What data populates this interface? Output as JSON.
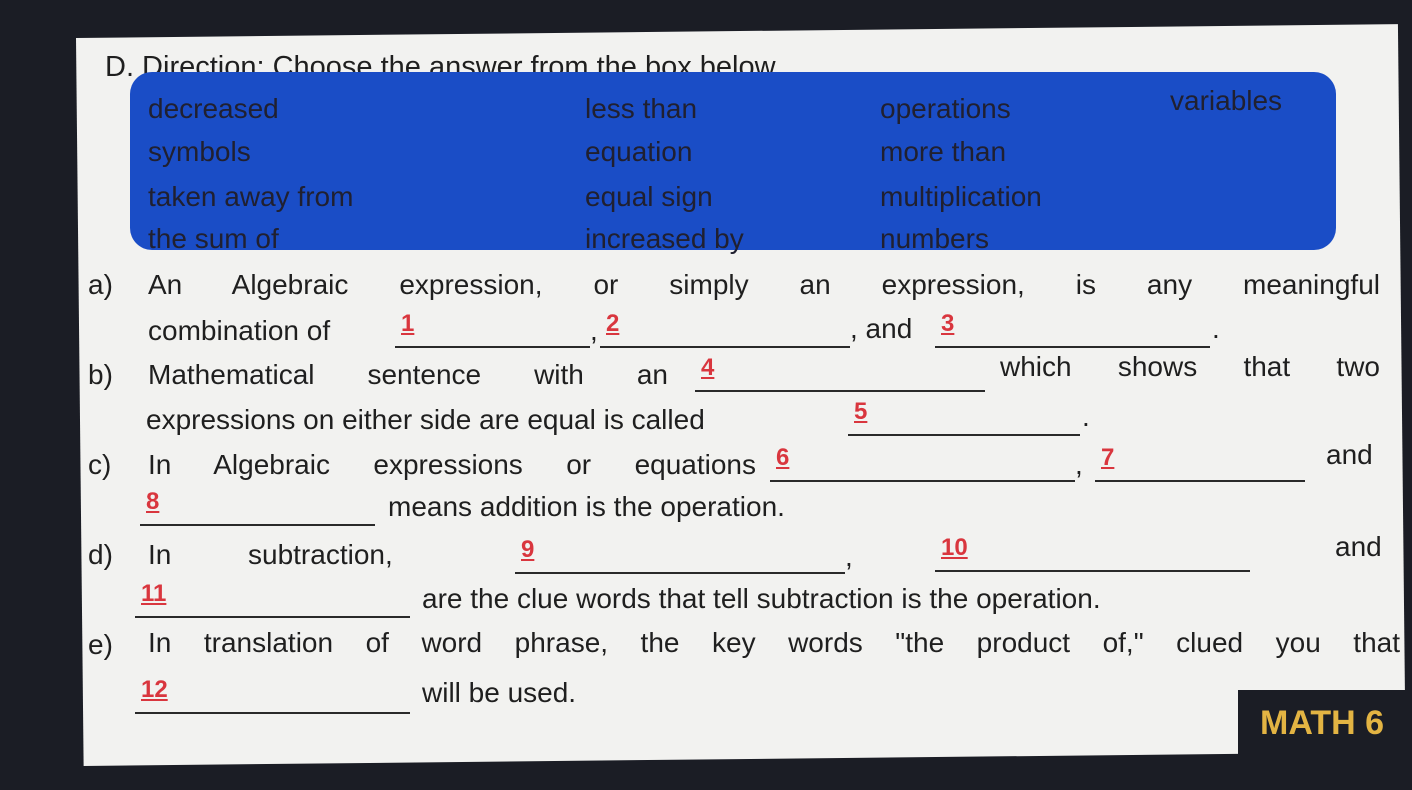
{
  "header": "D. Direction: Choose the answer from the box below.",
  "word_box": {
    "color": "#1a4dc6",
    "words": [
      [
        "decreased",
        "less than",
        "operations",
        "variables"
      ],
      [
        "symbols",
        "equation",
        "more than",
        ""
      ],
      [
        "taken away from",
        "equal sign",
        "multiplication",
        ""
      ],
      [
        "the sum of",
        "increased by",
        "numbers",
        ""
      ]
    ]
  },
  "items": {
    "a": {
      "label": "a)",
      "line1": "An Algebraic expression, or simply an expression, is any meaningful",
      "line2_start": "combination of",
      "sep1": ",",
      "sep2": ", and",
      "end": ".",
      "blanks": [
        "1",
        "2",
        "3"
      ]
    },
    "b": {
      "label": "b)",
      "line1_start": "Mathematical sentence with an",
      "line1_end": "which shows that two",
      "line2_start": "expressions on either side are equal is called",
      "end": ".",
      "blanks": [
        "4",
        "5"
      ]
    },
    "c": {
      "label": "c)",
      "line1_start": "In Algebraic expressions or equations",
      "sep1": ",",
      "line1_end": "and",
      "line2_end": "means addition is the operation.",
      "blanks": [
        "6",
        "7",
        "8"
      ]
    },
    "d": {
      "label": "d)",
      "in": "In",
      "subtraction": "subtraction,",
      "sep1": ",",
      "line1_end": "and",
      "line2_end": "are the clue words that tell subtraction is the operation.",
      "blanks": [
        "9",
        "10",
        "11"
      ]
    },
    "e": {
      "label": "e)",
      "line1": "In translation of word phrase, the key words \"the product of,\" clued you that",
      "line2_end": "will be used.",
      "blanks": [
        "12"
      ]
    }
  },
  "footer": {
    "label": "MATH 6",
    "color": "#e3b443"
  },
  "blank_number_color": "#d9363e"
}
